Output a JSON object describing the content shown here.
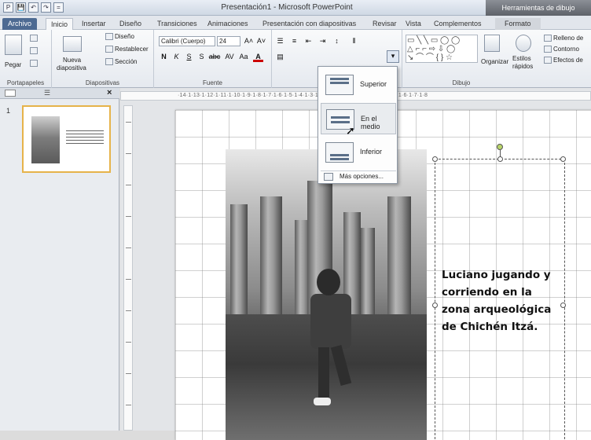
{
  "window": {
    "title": "Presentación1 - Microsoft PowerPoint",
    "contextual_title": "Herramientas de dibujo"
  },
  "qat": [
    "P",
    "💾",
    "↶",
    "↷",
    "="
  ],
  "tabs": [
    {
      "label": "Archivo"
    },
    {
      "label": "Inicio"
    },
    {
      "label": "Insertar"
    },
    {
      "label": "Diseño"
    },
    {
      "label": "Transiciones"
    },
    {
      "label": "Animaciones"
    },
    {
      "label": "Presentación con diapositivas"
    },
    {
      "label": "Revisar"
    },
    {
      "label": "Vista"
    },
    {
      "label": "Complementos"
    },
    {
      "label": "Formato"
    }
  ],
  "ribbon": {
    "clipboard": {
      "paste": "Pegar",
      "group": "Portapapeles"
    },
    "slides": {
      "new_slide_1": "Nueva",
      "new_slide_2": "diapositiva",
      "layout": "Diseño",
      "reset": "Restablecer",
      "section": "Sección",
      "group": "Diapositivas"
    },
    "font": {
      "name": "Calibri (Cuerpo)",
      "size": "24",
      "bold": "N",
      "italic": "K",
      "underline": "S",
      "shadow": "S",
      "strike": "abc",
      "spacing": "AV",
      "case": "Aa",
      "color": "A",
      "group": "Fuente"
    },
    "drawing": {
      "arrange": "Organizar",
      "quick_styles_1": "Estilos",
      "quick_styles_2": "rápidos",
      "fill": "Relleno de",
      "outline": "Contorno",
      "effects": "Efectos de",
      "group": "Dibujo"
    }
  },
  "ruler_text": "·14·1·13·1·12·1·11·1·10·1·9·1·8·1·7·1·6·1·5·1·4·1·3·1·2·1·1·1·0·1·1·1·2·1·3·1·4·1·5·1·6·1·7·1·8",
  "slide_number": "1",
  "caption_text": "Luciano jugando y corriendo en la zona arqueológica de Chichén Itzá.",
  "align_menu": {
    "items": [
      {
        "label": "Superior"
      },
      {
        "label": "En el medio"
      },
      {
        "label": "Inferior"
      }
    ],
    "more": "Más opciones..."
  }
}
